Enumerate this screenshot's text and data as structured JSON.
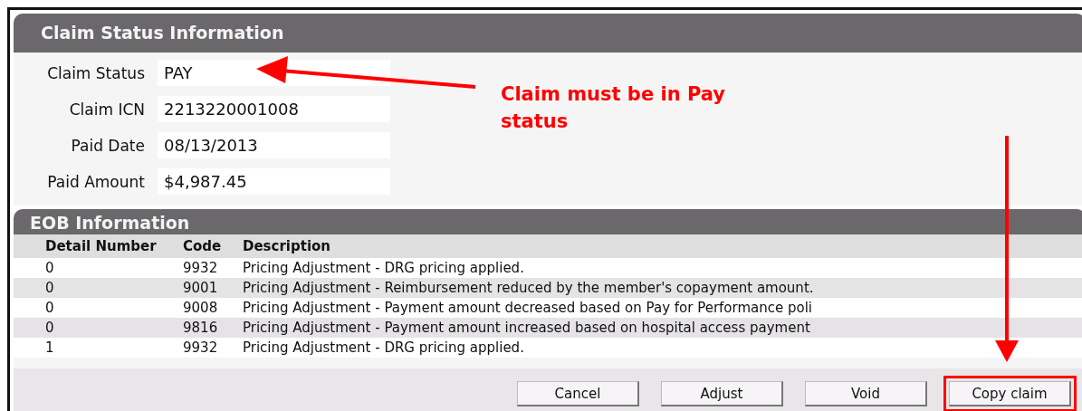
{
  "claim_status_panel": {
    "title": "Claim Status Information",
    "fields": [
      {
        "label": "Claim Status",
        "value": "PAY"
      },
      {
        "label": "Claim ICN",
        "value": "2213220001008"
      },
      {
        "label": "Paid Date",
        "value": "08/13/2013"
      },
      {
        "label": "Paid Amount",
        "value": "$4,987.45"
      }
    ]
  },
  "annotation": {
    "note": "Claim must be in Pay status"
  },
  "eob_panel": {
    "title": "EOB Information",
    "table": {
      "columns": [
        "Detail Number",
        "Code",
        "Description"
      ],
      "rows": [
        [
          "0",
          "9932",
          "Pricing Adjustment - DRG pricing applied."
        ],
        [
          "0",
          "9001",
          "Pricing Adjustment - Reimbursement reduced by the member's copayment amount."
        ],
        [
          "0",
          "9008",
          "Pricing Adjustment - Payment amount decreased based on Pay for Performance poli"
        ],
        [
          "0",
          "9816",
          "Pricing Adjustment - Payment amount increased based on hospital access payment"
        ],
        [
          "1",
          "9932",
          "Pricing Adjustment - DRG pricing applied."
        ]
      ]
    },
    "buttons": [
      {
        "label": "Cancel",
        "highlighted": false
      },
      {
        "label": "Adjust",
        "highlighted": false
      },
      {
        "label": "Void",
        "highlighted": false
      },
      {
        "label": "Copy claim",
        "highlighted": true
      }
    ]
  }
}
